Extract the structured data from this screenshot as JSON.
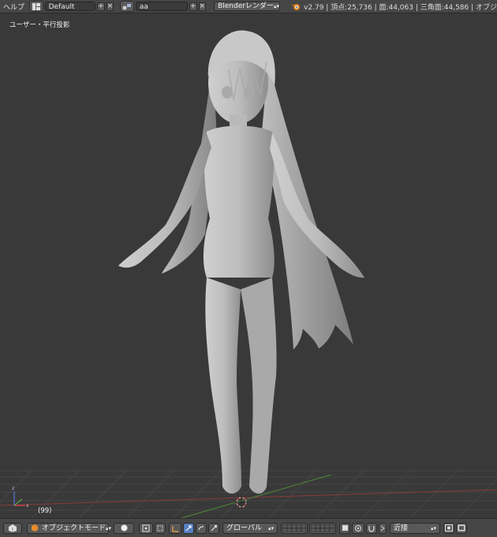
{
  "header": {
    "help_menu": "ヘルプ",
    "screen_layout": "Default",
    "scene_name": "aa",
    "render_engine": "Blenderレンダー",
    "stats": "v2.79 | 頂点:25,736 | 面:44,063 | 三角面:44,586 | オブジ"
  },
  "viewport": {
    "view_label": "ユーザー・平行投影",
    "frame_label": "(99)"
  },
  "footer": {
    "mode": "オブジェクトモード",
    "orientation": "グローバル",
    "snap_target": "近接"
  }
}
